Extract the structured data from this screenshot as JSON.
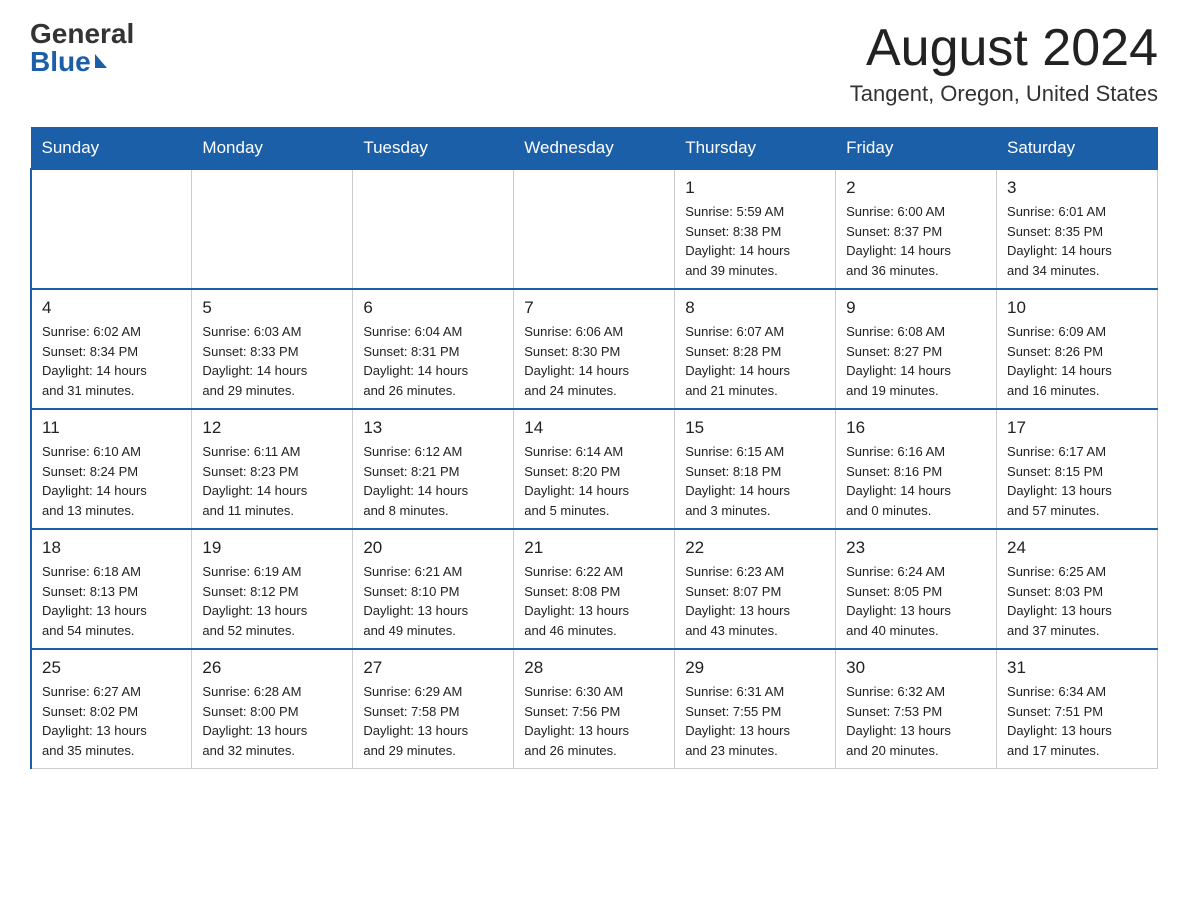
{
  "header": {
    "logo_general": "General",
    "logo_blue": "Blue",
    "month_title": "August 2024",
    "location": "Tangent, Oregon, United States"
  },
  "weekdays": [
    "Sunday",
    "Monday",
    "Tuesday",
    "Wednesday",
    "Thursday",
    "Friday",
    "Saturday"
  ],
  "weeks": [
    [
      {
        "day": "",
        "info": ""
      },
      {
        "day": "",
        "info": ""
      },
      {
        "day": "",
        "info": ""
      },
      {
        "day": "",
        "info": ""
      },
      {
        "day": "1",
        "info": "Sunrise: 5:59 AM\nSunset: 8:38 PM\nDaylight: 14 hours\nand 39 minutes."
      },
      {
        "day": "2",
        "info": "Sunrise: 6:00 AM\nSunset: 8:37 PM\nDaylight: 14 hours\nand 36 minutes."
      },
      {
        "day": "3",
        "info": "Sunrise: 6:01 AM\nSunset: 8:35 PM\nDaylight: 14 hours\nand 34 minutes."
      }
    ],
    [
      {
        "day": "4",
        "info": "Sunrise: 6:02 AM\nSunset: 8:34 PM\nDaylight: 14 hours\nand 31 minutes."
      },
      {
        "day": "5",
        "info": "Sunrise: 6:03 AM\nSunset: 8:33 PM\nDaylight: 14 hours\nand 29 minutes."
      },
      {
        "day": "6",
        "info": "Sunrise: 6:04 AM\nSunset: 8:31 PM\nDaylight: 14 hours\nand 26 minutes."
      },
      {
        "day": "7",
        "info": "Sunrise: 6:06 AM\nSunset: 8:30 PM\nDaylight: 14 hours\nand 24 minutes."
      },
      {
        "day": "8",
        "info": "Sunrise: 6:07 AM\nSunset: 8:28 PM\nDaylight: 14 hours\nand 21 minutes."
      },
      {
        "day": "9",
        "info": "Sunrise: 6:08 AM\nSunset: 8:27 PM\nDaylight: 14 hours\nand 19 minutes."
      },
      {
        "day": "10",
        "info": "Sunrise: 6:09 AM\nSunset: 8:26 PM\nDaylight: 14 hours\nand 16 minutes."
      }
    ],
    [
      {
        "day": "11",
        "info": "Sunrise: 6:10 AM\nSunset: 8:24 PM\nDaylight: 14 hours\nand 13 minutes."
      },
      {
        "day": "12",
        "info": "Sunrise: 6:11 AM\nSunset: 8:23 PM\nDaylight: 14 hours\nand 11 minutes."
      },
      {
        "day": "13",
        "info": "Sunrise: 6:12 AM\nSunset: 8:21 PM\nDaylight: 14 hours\nand 8 minutes."
      },
      {
        "day": "14",
        "info": "Sunrise: 6:14 AM\nSunset: 8:20 PM\nDaylight: 14 hours\nand 5 minutes."
      },
      {
        "day": "15",
        "info": "Sunrise: 6:15 AM\nSunset: 8:18 PM\nDaylight: 14 hours\nand 3 minutes."
      },
      {
        "day": "16",
        "info": "Sunrise: 6:16 AM\nSunset: 8:16 PM\nDaylight: 14 hours\nand 0 minutes."
      },
      {
        "day": "17",
        "info": "Sunrise: 6:17 AM\nSunset: 8:15 PM\nDaylight: 13 hours\nand 57 minutes."
      }
    ],
    [
      {
        "day": "18",
        "info": "Sunrise: 6:18 AM\nSunset: 8:13 PM\nDaylight: 13 hours\nand 54 minutes."
      },
      {
        "day": "19",
        "info": "Sunrise: 6:19 AM\nSunset: 8:12 PM\nDaylight: 13 hours\nand 52 minutes."
      },
      {
        "day": "20",
        "info": "Sunrise: 6:21 AM\nSunset: 8:10 PM\nDaylight: 13 hours\nand 49 minutes."
      },
      {
        "day": "21",
        "info": "Sunrise: 6:22 AM\nSunset: 8:08 PM\nDaylight: 13 hours\nand 46 minutes."
      },
      {
        "day": "22",
        "info": "Sunrise: 6:23 AM\nSunset: 8:07 PM\nDaylight: 13 hours\nand 43 minutes."
      },
      {
        "day": "23",
        "info": "Sunrise: 6:24 AM\nSunset: 8:05 PM\nDaylight: 13 hours\nand 40 minutes."
      },
      {
        "day": "24",
        "info": "Sunrise: 6:25 AM\nSunset: 8:03 PM\nDaylight: 13 hours\nand 37 minutes."
      }
    ],
    [
      {
        "day": "25",
        "info": "Sunrise: 6:27 AM\nSunset: 8:02 PM\nDaylight: 13 hours\nand 35 minutes."
      },
      {
        "day": "26",
        "info": "Sunrise: 6:28 AM\nSunset: 8:00 PM\nDaylight: 13 hours\nand 32 minutes."
      },
      {
        "day": "27",
        "info": "Sunrise: 6:29 AM\nSunset: 7:58 PM\nDaylight: 13 hours\nand 29 minutes."
      },
      {
        "day": "28",
        "info": "Sunrise: 6:30 AM\nSunset: 7:56 PM\nDaylight: 13 hours\nand 26 minutes."
      },
      {
        "day": "29",
        "info": "Sunrise: 6:31 AM\nSunset: 7:55 PM\nDaylight: 13 hours\nand 23 minutes."
      },
      {
        "day": "30",
        "info": "Sunrise: 6:32 AM\nSunset: 7:53 PM\nDaylight: 13 hours\nand 20 minutes."
      },
      {
        "day": "31",
        "info": "Sunrise: 6:34 AM\nSunset: 7:51 PM\nDaylight: 13 hours\nand 17 minutes."
      }
    ]
  ]
}
